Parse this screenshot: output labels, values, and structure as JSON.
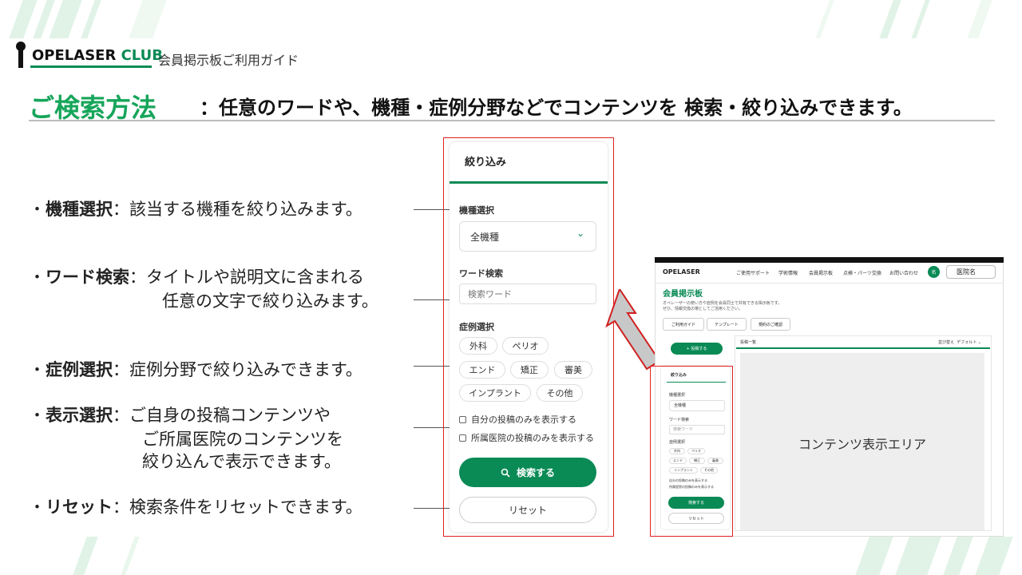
{
  "header": {
    "logo_main": "OPELASER",
    "logo_club": "CLUB",
    "subtitle": "会員掲示板ご利用ガイド",
    "title": "ご検索方法",
    "title_desc": "：任意のワードや、機種・症例分野などでコンテンツを 検索・絞り込みできます。"
  },
  "descriptions": [
    {
      "bullet": "・",
      "term": "機種選択",
      "sep": "：",
      "lines": [
        "該当する機種を絞り込みます。"
      ]
    },
    {
      "bullet": "・",
      "term": "ワード検索",
      "sep": "：",
      "lines": [
        "タイトルや説明文に含まれる",
        "任意の文字で絞り込みます。"
      ]
    },
    {
      "bullet": "・",
      "term": "症例選択",
      "sep": "：",
      "lines": [
        "症例分野で絞り込みできます。"
      ]
    },
    {
      "bullet": "・",
      "term": "表示選択",
      "sep": "：",
      "lines": [
        "ご自身の投稿コンテンツや",
        "ご所属医院のコンテンツを",
        "絞り込んで表示できます。"
      ]
    },
    {
      "bullet": "・",
      "term": "リセット",
      "sep": "：",
      "lines": [
        "検索条件をリセットできます。"
      ]
    }
  ],
  "filter_panel": {
    "title": "絞り込み",
    "model_label": "機種選択",
    "model_value": "全機種",
    "word_label": "ワード検索",
    "word_placeholder": "検索ワード",
    "case_label": "症例選択",
    "case_chips": [
      "外科",
      "ペリオ",
      "エンド",
      "矯正",
      "審美",
      "インプラント",
      "その他"
    ],
    "checkbox_own": "自分の投稿のみを表示する",
    "checkbox_clinic": "所属医院の投稿のみを表示する",
    "search_button": "検索する",
    "reset_button": "リセット"
  },
  "screenshot": {
    "logo": "OPELASER",
    "nav": [
      "ご使用サポート",
      "学術情報",
      "会員掲示板",
      "点検・パーツ交換",
      "お問い合わせ"
    ],
    "avatar": "名",
    "hospital": "医院名",
    "heading": "会員掲示板",
    "description_lines": [
      "オペレーザーの使い方や症例を会員同士で共有できる掲示板です。",
      "ぜひ、情報交換の場としてご活用ください。"
    ],
    "buttons": [
      "ご利用ガイド",
      "テンプレート",
      "規約のご確認"
    ],
    "post_button": "+ 投稿する",
    "list_title": "投稿一覧",
    "sort_label": "並び替え",
    "sort_value": "デフォルト",
    "content_area": "コンテンツ表示エリア",
    "panel": {
      "title": "絞り込み",
      "model_label": "機種選択",
      "model_value": "全機種",
      "word_label": "ワード検索",
      "word_placeholder": "検索ワード",
      "case_label": "症例選択",
      "chips": [
        "外科",
        "ペリオ",
        "エンド",
        "矯正",
        "審美",
        "インプラント",
        "その他"
      ],
      "cb1": "自分の投稿のみを表示する",
      "cb2": "所属医院の投稿のみを表示する",
      "search": "検索する",
      "reset": "リセット"
    }
  },
  "colors": {
    "accent": "#0a8a55",
    "title_green": "#16a55a",
    "highlight_red": "#e02020"
  }
}
